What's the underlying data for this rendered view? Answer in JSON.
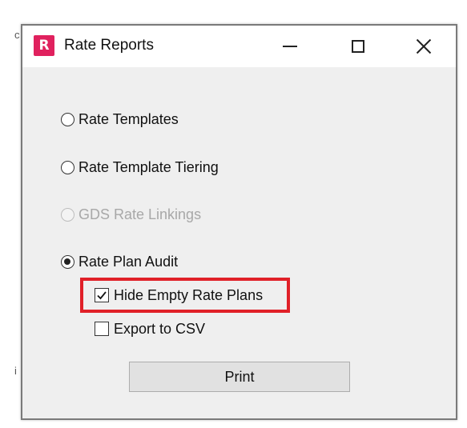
{
  "window": {
    "title": "Rate Reports",
    "app_icon_letter": "R",
    "app_icon_color": "#e0215e"
  },
  "options": {
    "rate_templates": {
      "label": "Rate Templates",
      "selected": false,
      "enabled": true
    },
    "rate_template_tiering": {
      "label": "Rate Template Tiering",
      "selected": false,
      "enabled": true
    },
    "gds_rate_linkings": {
      "label": "GDS Rate Linkings",
      "selected": false,
      "enabled": false
    },
    "rate_plan_audit": {
      "label": "Rate Plan Audit",
      "selected": true,
      "enabled": true
    }
  },
  "checkboxes": {
    "hide_empty_rate_plans": {
      "label": "Hide Empty Rate Plans",
      "checked": true,
      "highlighted": true
    },
    "export_to_csv": {
      "label": "Export to CSV",
      "checked": false
    }
  },
  "buttons": {
    "print_label": "Print"
  },
  "colors": {
    "highlight_border": "#e02028",
    "dialog_background": "#efefef"
  }
}
